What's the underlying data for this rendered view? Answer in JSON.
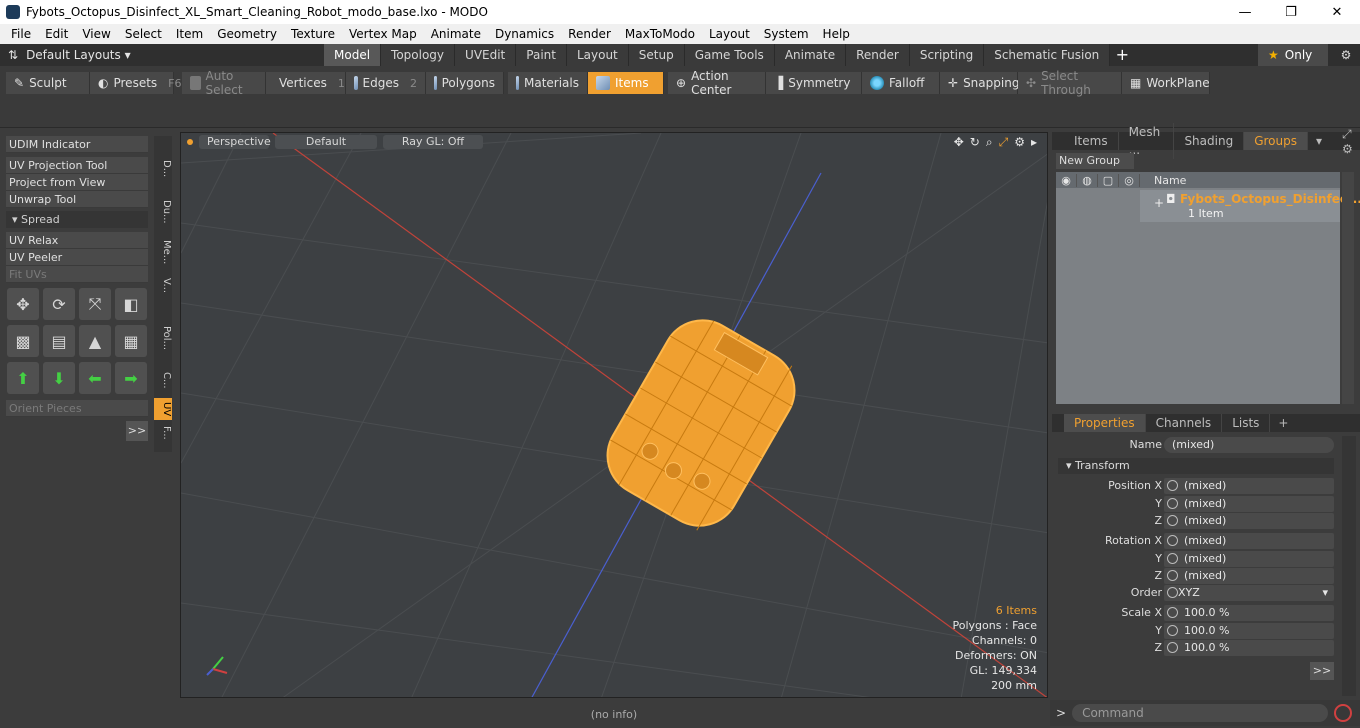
{
  "window": {
    "title": "Fybots_Octopus_Disinfect_XL_Smart_Cleaning_Robot_modo_base.lxo - MODO",
    "minimize": "—",
    "restore": "❐",
    "close": "✕"
  },
  "menu": [
    "File",
    "Edit",
    "View",
    "Select",
    "Item",
    "Geometry",
    "Texture",
    "Vertex Map",
    "Animate",
    "Dynamics",
    "Render",
    "MaxToModo",
    "Layout",
    "System",
    "Help"
  ],
  "layout_row": {
    "layout_label": "Default Layouts ▾",
    "tabs": [
      "Model",
      "Topology",
      "UVEdit",
      "Paint",
      "Layout",
      "Setup",
      "Game Tools",
      "Animate",
      "Render",
      "Scripting",
      "Schematic Fusion"
    ],
    "active_tab": "Model",
    "only_label": "Only"
  },
  "toolbar": {
    "sculpt": "Sculpt",
    "presets": "Presets",
    "presets_key": "F6",
    "auto_select": "Auto Select",
    "vertices": "Vertices",
    "vertices_num": "1",
    "edges": "Edges",
    "edges_num": "2",
    "polygons": "Polygons",
    "materials": "Materials",
    "items": "Items",
    "action_center": "Action Center",
    "symmetry": "Symmetry",
    "falloff": "Falloff",
    "snapping": "Snapping",
    "select_through": "Select Through",
    "workplane": "WorkPlane"
  },
  "left_panel": {
    "udim": "UDIM Indicator",
    "uv_projection": "UV Projection Tool",
    "project_from_view": "Project from View",
    "unwrap": "Unwrap Tool",
    "spread": "Spread",
    "uv_relax": "UV Relax",
    "uv_peeler": "UV Peeler",
    "fit_uvs": "Fit UVs",
    "orient_pieces": "Orient Pieces",
    "more": ">>",
    "vtabs": [
      "D...",
      "Du...",
      "Me...",
      "V...",
      "Pol...",
      "C...",
      "UV",
      "F..."
    ]
  },
  "viewport": {
    "view": "Perspective",
    "shading": "Default",
    "raygl": "Ray GL: Off",
    "info": {
      "items": "6 Items",
      "polygons": "Polygons : Face",
      "channels": "Channels: 0",
      "deformers": "Deformers: ON",
      "gl": "GL: 149,334",
      "scale": "200 mm"
    }
  },
  "status": "(no info)",
  "command_placeholder": "Command",
  "groups_panel": {
    "tabs": [
      "Items",
      "Mesh ...",
      "Shading",
      "Groups"
    ],
    "active_tab": "Groups",
    "new_group": "New Group",
    "col_name": "Name",
    "group_name": "Fybots_Octopus_Disinfect...",
    "group_sub": "1 Item"
  },
  "properties_panel": {
    "tabs": [
      "Properties",
      "Channels",
      "Lists"
    ],
    "active_tab": "Properties",
    "name_label": "Name",
    "name_value": "(mixed)",
    "transform": "Transform",
    "position_x_label": "Position X",
    "position_x": "(mixed)",
    "position_y": "(mixed)",
    "position_z": "(mixed)",
    "rotation_x_label": "Rotation X",
    "rotation_x": "(mixed)",
    "rotation_y": "(mixed)",
    "rotation_z": "(mixed)",
    "order_label": "Order",
    "order_value": "XYZ",
    "scale_x_label": "Scale X",
    "scale_x": "100.0 %",
    "scale_y": "100.0 %",
    "scale_z": "100.0 %",
    "y_label": "Y",
    "z_label": "Z",
    "more": ">>"
  },
  "colors": {
    "accent": "#f0a030",
    "viewport_bg": "#3d4043",
    "x_axis": "#c0433a",
    "z_axis": "#4a5fd0"
  }
}
